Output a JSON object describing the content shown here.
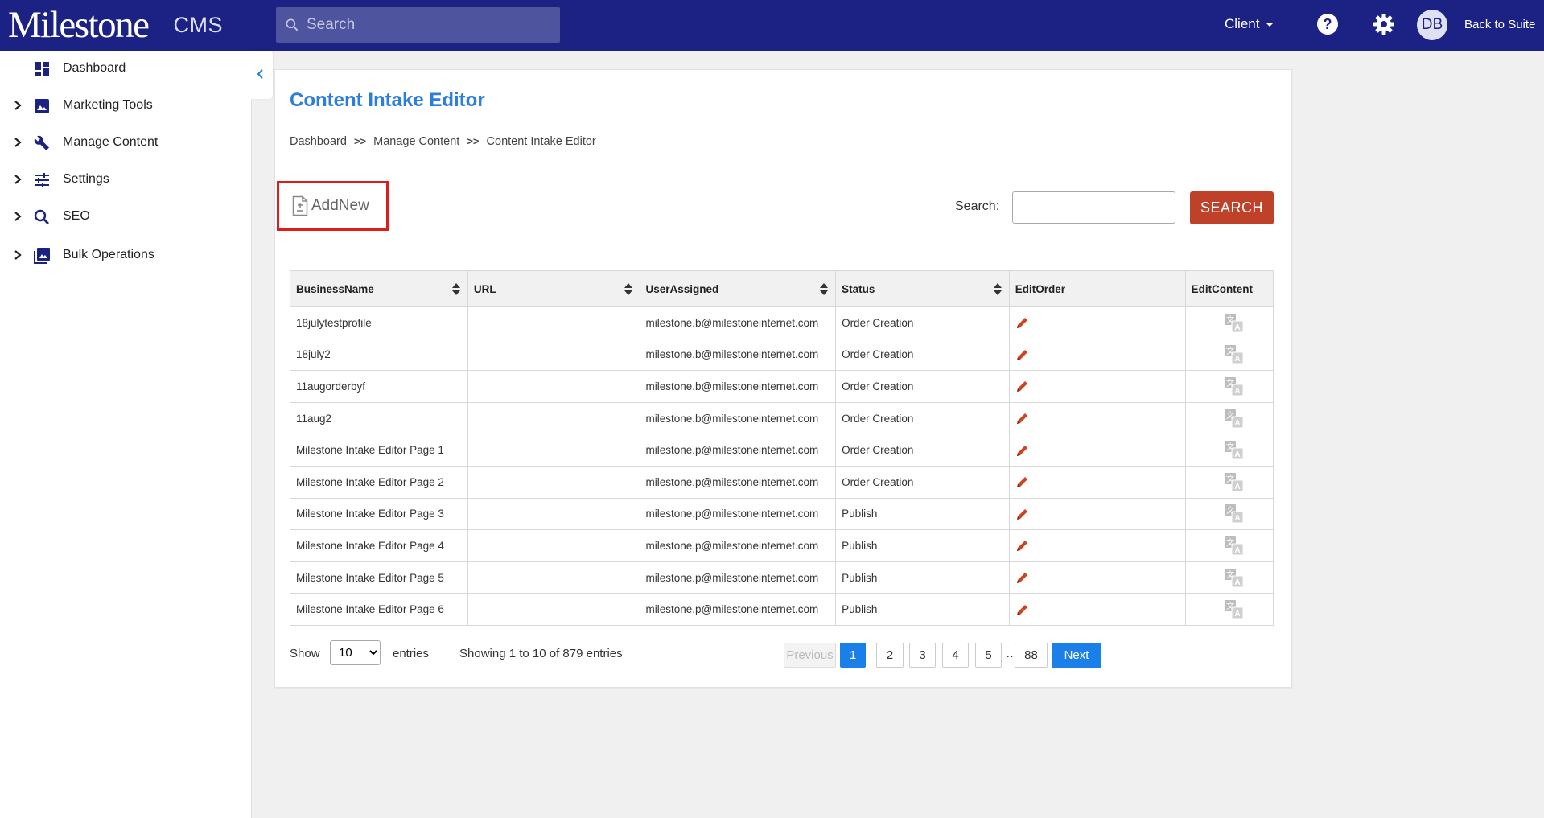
{
  "app": {
    "logo": "Milestone",
    "product": "CMS",
    "search_placeholder": "Search",
    "client_label": "Client",
    "avatar_initials": "DB",
    "back_label": "Back to Suite",
    "accent": "#1c2283"
  },
  "sidebar": {
    "items": [
      {
        "label": "Dashboard",
        "icon": "dashboard-icon",
        "expandable": false
      },
      {
        "label": "Marketing Tools",
        "icon": "image-icon",
        "expandable": true
      },
      {
        "label": "Manage Content",
        "icon": "wrench-icon",
        "expandable": true
      },
      {
        "label": "Settings",
        "icon": "sliders-icon",
        "expandable": true
      },
      {
        "label": "SEO",
        "icon": "search-icon",
        "expandable": true
      },
      {
        "label": "Bulk Operations",
        "icon": "image-stack-icon",
        "expandable": true
      }
    ]
  },
  "page": {
    "title": "Content Intake Editor",
    "breadcrumb": [
      "Dashboard",
      "Manage Content",
      "Content Intake Editor"
    ],
    "breadcrumb_sep": ">>",
    "add_new_label": "AddNew",
    "search_label": "Search:",
    "search_value": "",
    "search_button": "SEARCH"
  },
  "table": {
    "columns": [
      "BusinessName",
      "URL",
      "UserAssigned",
      "Status",
      "EditOrder",
      "EditContent"
    ],
    "rows": [
      {
        "business": "18julytestprofile",
        "url": "",
        "user": "milestone.b@milestoneinternet.com",
        "status": "Order Creation"
      },
      {
        "business": "18july2",
        "url": "",
        "user": "milestone.b@milestoneinternet.com",
        "status": "Order Creation"
      },
      {
        "business": "11augorderbyf",
        "url": "",
        "user": "milestone.b@milestoneinternet.com",
        "status": "Order Creation"
      },
      {
        "business": "11aug2",
        "url": "",
        "user": "milestone.b@milestoneinternet.com",
        "status": "Order Creation"
      },
      {
        "business": "Milestone Intake Editor Page 1",
        "url": "",
        "user": "milestone.p@milestoneinternet.com",
        "status": "Order Creation"
      },
      {
        "business": "Milestone Intake Editor Page 2",
        "url": "",
        "user": "milestone.p@milestoneinternet.com",
        "status": "Order Creation"
      },
      {
        "business": "Milestone Intake Editor Page 3",
        "url": "",
        "user": "milestone.p@milestoneinternet.com",
        "status": "Publish"
      },
      {
        "business": "Milestone Intake Editor Page 4",
        "url": "",
        "user": "milestone.p@milestoneinternet.com",
        "status": "Publish"
      },
      {
        "business": "Milestone Intake Editor Page 5",
        "url": "",
        "user": "milestone.p@milestoneinternet.com",
        "status": "Publish"
      },
      {
        "business": "Milestone Intake Editor Page 6",
        "url": "",
        "user": "milestone.p@milestoneinternet.com",
        "status": "Publish"
      }
    ]
  },
  "footer": {
    "show_label": "Show",
    "entries_value": "10",
    "entries_label": "entries",
    "showing_text": "Showing 1 to 10 of 879 entries",
    "prev_label": "Previous",
    "next_label": "Next",
    "pages": [
      "1",
      "2",
      "3",
      "4",
      "5"
    ],
    "ellipsis": "…",
    "last_page": "88"
  },
  "colors": {
    "title_blue": "#2a7de1",
    "search_button": "#c0412a",
    "edit_pencil": "#d0431f",
    "highlight_border": "#e01b1b",
    "active_page": "#1a7fe8"
  }
}
